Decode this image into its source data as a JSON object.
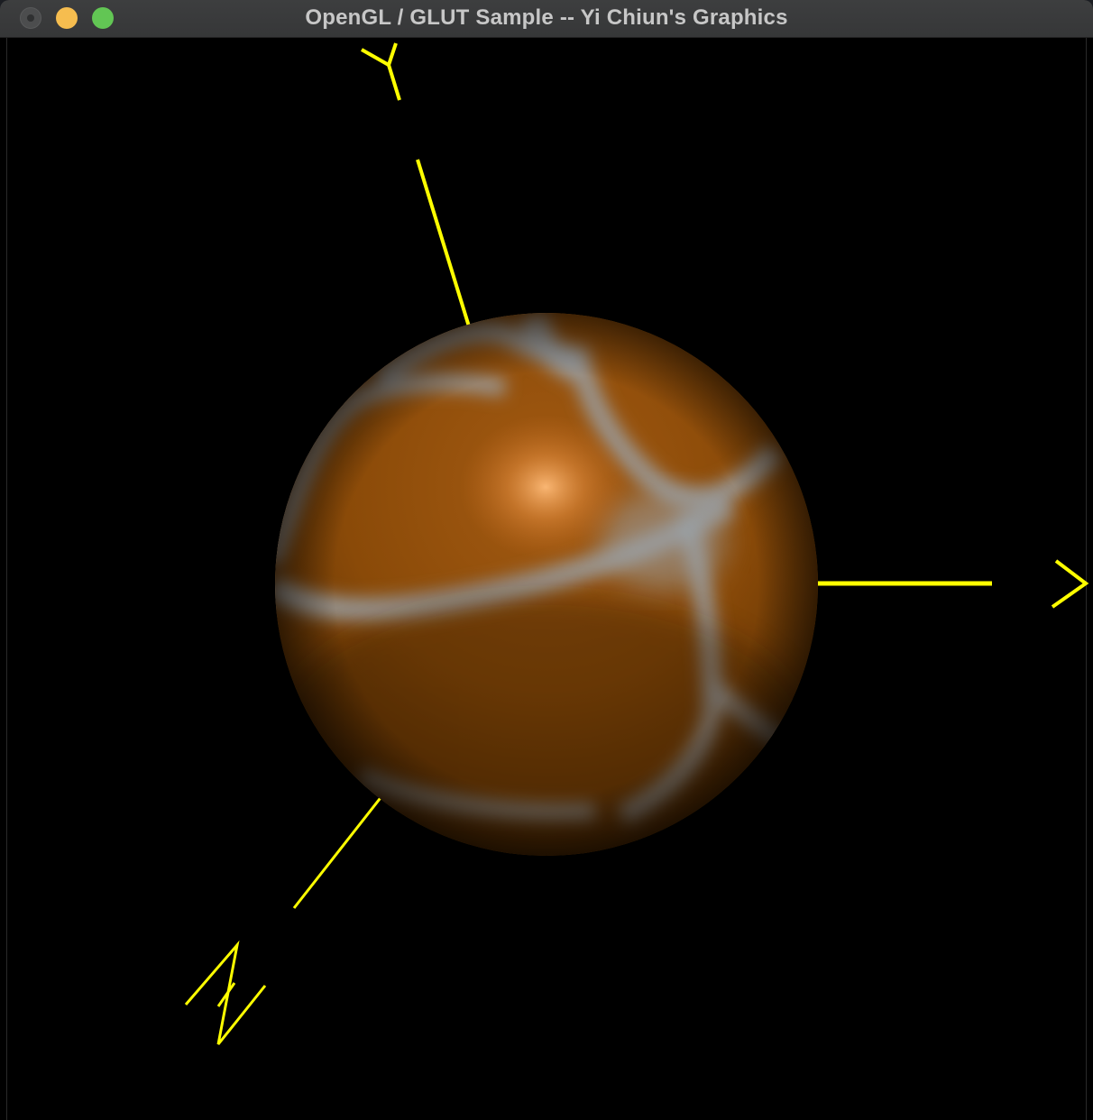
{
  "window": {
    "title": "OpenGL / GLUT Sample -- Yi Chiun's Graphics",
    "controls": [
      "close-icon",
      "minimize-icon",
      "maximize-icon"
    ]
  },
  "scene": {
    "background_color": "#000000",
    "axis_color": "#ffff00",
    "sphere_base_color": "#8a4a08",
    "sphere_highlight_color": "#f9b673",
    "sphere_seam_color": "#9aa0a5",
    "axes": [
      {
        "name": "X",
        "glyph": "X"
      },
      {
        "name": "Y",
        "glyph": "Y"
      },
      {
        "name": "Z",
        "glyph": "Z"
      }
    ]
  }
}
